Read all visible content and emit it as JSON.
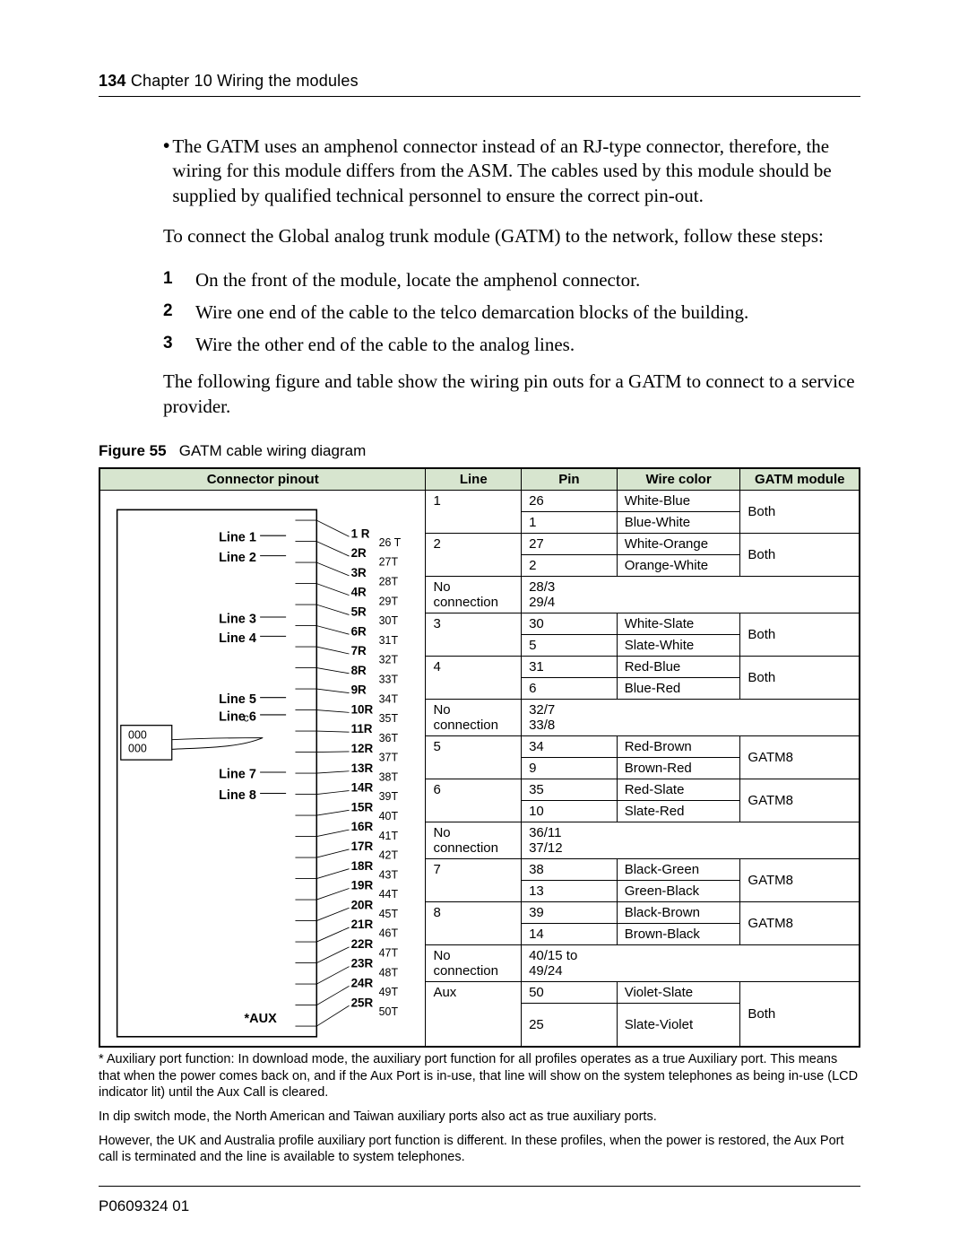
{
  "header": {
    "page_number": "134",
    "chapter": "Chapter 10 Wiring the modules"
  },
  "bullet": "The GATM uses an amphenol connector instead of an RJ-type connector, therefore, the wiring for this module differs from the ASM. The cables used by this module should be supplied by qualified technical personnel to ensure the correct pin-out.",
  "lead_in": "To connect the Global analog trunk module (GATM) to the network, follow these steps:",
  "steps": [
    "On the front of the module, locate the amphenol connector.",
    "Wire one end of the cable to the telco demarcation blocks of the building.",
    "Wire the other end of the cable to the analog lines."
  ],
  "steps_followup": "The following figure and table show the wiring pin outs for a GATM to connect to a service provider.",
  "figure": {
    "label": "Figure 55",
    "title": "GATM cable wiring diagram"
  },
  "columns": {
    "connector": "Connector pinout",
    "line": "Line",
    "pin": "Pin",
    "wire": "Wire color",
    "module": "GATM module"
  },
  "labels": {
    "no_connection": "No connection",
    "aux_line": "Aux",
    "aux_marker": "*AUX"
  },
  "line_labels": [
    "Line 1",
    "Line 2",
    "Line 3",
    "Line 4",
    "Line 5",
    "Line 6",
    "Line 7",
    "Line 8"
  ],
  "r_pins": [
    "1 R",
    "2R",
    "3R",
    "4R",
    "5R",
    "6R",
    "7R",
    "8R",
    "9R",
    "10R",
    "11R",
    "12R",
    "13R",
    "14R",
    "15R",
    "16R",
    "17R",
    "18R",
    "19R",
    "20R",
    "21R",
    "22R",
    "23R",
    "24R",
    "25R"
  ],
  "t_pins": [
    "26 T",
    "27T",
    "28T",
    "29T",
    "30T",
    "31T",
    "32T",
    "33T",
    "34T",
    "35T",
    "36T",
    "37T",
    "38T",
    "39T",
    "40T",
    "41T",
    "42T",
    "43T",
    "44T",
    "45T",
    "46T",
    "47T",
    "48T",
    "49T",
    "50T"
  ],
  "rows": [
    {
      "line": "1",
      "pin": "26",
      "wire": "White-Blue",
      "module": "Both",
      "top": true
    },
    {
      "line": "",
      "pin": "1",
      "wire": "Blue-White",
      "module": ""
    },
    {
      "line": "2",
      "pin": "27",
      "wire": "White-Orange",
      "module": "Both",
      "top": true
    },
    {
      "line": "",
      "pin": "2",
      "wire": "Orange-White",
      "module": ""
    },
    {
      "nc": true,
      "pins": [
        "28/3",
        "29/4"
      ]
    },
    {
      "line": "3",
      "pin": "30",
      "wire": "White-Slate",
      "module": "Both",
      "top": true
    },
    {
      "line": "",
      "pin": "5",
      "wire": "Slate-White",
      "module": ""
    },
    {
      "line": "4",
      "pin": "31",
      "wire": "Red-Blue",
      "module": "Both",
      "top": true
    },
    {
      "line": "",
      "pin": "6",
      "wire": "Blue-Red",
      "module": ""
    },
    {
      "nc": true,
      "pins": [
        "32/7",
        "33/8"
      ]
    },
    {
      "line": "5",
      "pin": "34",
      "wire": "Red-Brown",
      "module": "GATM8",
      "top": true
    },
    {
      "line": "",
      "pin": "9",
      "wire": "Brown-Red",
      "module": ""
    },
    {
      "line": "6",
      "pin": "35",
      "wire": "Red-Slate",
      "module": "GATM8",
      "top": true
    },
    {
      "line": "",
      "pin": "10",
      "wire": "Slate-Red",
      "module": ""
    },
    {
      "nc": true,
      "pins": [
        "36/11",
        "37/12"
      ]
    },
    {
      "line": "7",
      "pin": "38",
      "wire": "Black-Green",
      "module": "GATM8",
      "top": true
    },
    {
      "line": "",
      "pin": "13",
      "wire": "Green-Black",
      "module": ""
    },
    {
      "line": "8",
      "pin": "39",
      "wire": "Black-Brown",
      "module": "GATM8",
      "top": true
    },
    {
      "line": "",
      "pin": "14",
      "wire": "Brown-Black",
      "module": ""
    },
    {
      "nc": true,
      "pins": [
        "40/15 to",
        "49/24"
      ]
    },
    {
      "line": "Aux",
      "pin": "50",
      "wire": "Violet-Slate",
      "module": "Both",
      "top": true,
      "tall_module": true
    },
    {
      "line": "",
      "pin": "25",
      "wire": "Slate-Violet",
      "module": "",
      "tall": true
    }
  ],
  "chart_data": {
    "type": "table",
    "title": "GATM cable wiring diagram — pinouts",
    "columns": [
      "Line",
      "Pin",
      "Wire color",
      "GATM module"
    ],
    "data": [
      [
        "1",
        "26",
        "White-Blue",
        "Both"
      ],
      [
        "1",
        "1",
        "Blue-White",
        "Both"
      ],
      [
        "2",
        "27",
        "White-Orange",
        "Both"
      ],
      [
        "2",
        "2",
        "Orange-White",
        "Both"
      ],
      [
        "No connection",
        "28/3",
        "",
        ""
      ],
      [
        "No connection",
        "29/4",
        "",
        ""
      ],
      [
        "3",
        "30",
        "White-Slate",
        "Both"
      ],
      [
        "3",
        "5",
        "Slate-White",
        "Both"
      ],
      [
        "4",
        "31",
        "Red-Blue",
        "Both"
      ],
      [
        "4",
        "6",
        "Blue-Red",
        "Both"
      ],
      [
        "No connection",
        "32/7",
        "",
        ""
      ],
      [
        "No connection",
        "33/8",
        "",
        ""
      ],
      [
        "5",
        "34",
        "Red-Brown",
        "GATM8"
      ],
      [
        "5",
        "9",
        "Brown-Red",
        "GATM8"
      ],
      [
        "6",
        "35",
        "Red-Slate",
        "GATM8"
      ],
      [
        "6",
        "10",
        "Slate-Red",
        "GATM8"
      ],
      [
        "No connection",
        "36/11",
        "",
        ""
      ],
      [
        "No connection",
        "37/12",
        "",
        ""
      ],
      [
        "7",
        "38",
        "Black-Green",
        "GATM8"
      ],
      [
        "7",
        "13",
        "Green-Black",
        "GATM8"
      ],
      [
        "8",
        "39",
        "Black-Brown",
        "GATM8"
      ],
      [
        "8",
        "14",
        "Brown-Black",
        "GATM8"
      ],
      [
        "No connection",
        "40/15 to 49/24",
        "",
        ""
      ],
      [
        "Aux",
        "50",
        "Violet-Slate",
        "Both"
      ],
      [
        "Aux",
        "25",
        "Slate-Violet",
        "Both"
      ]
    ]
  },
  "notes": [
    "* Auxiliary port function: In download mode, the auxiliary port function for all profiles operates as a true Auxiliary port. This means that when the power comes back on, and if the Aux Port is in-use, that line will show on the system telephones as being in-use (LCD indicator lit) until the Aux Call is cleared.",
    "In dip switch mode, the North American and Taiwan auxiliary ports also act as true auxiliary ports.",
    "However, the UK and Australia profile auxiliary port function is different. In these profiles, when the power is restored, the Aux Port call is terminated and the line is available to system telephones."
  ],
  "footer": "P0609324  01"
}
